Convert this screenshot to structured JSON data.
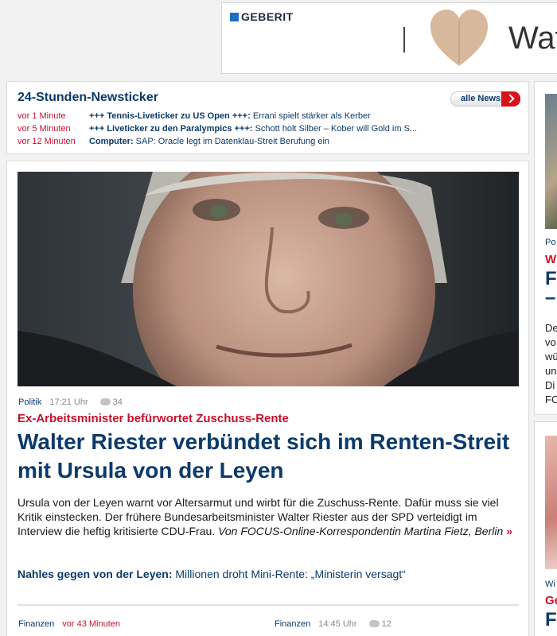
{
  "ad": {
    "brand": "GEBERIT",
    "slogan": "Wat"
  },
  "ticker": {
    "title": "24-Stunden-Newsticker",
    "all_news_label": "alle News",
    "items": [
      {
        "time": "vor 1 Minute",
        "category": "+++ Tennis-Liveticker zu US Open +++:",
        "text": "Errani spielt stärker als Kerber"
      },
      {
        "time": "vor 5 Minuten",
        "category": "+++ Liveticker zu den Paralympics +++:",
        "text": "Schott holt Silber – Kober will Gold im S..."
      },
      {
        "time": "vor 12 Minuten",
        "category": "Computer:",
        "text": "SAP: Oracle legt im Datenklau-Streit Berufung ein"
      }
    ]
  },
  "article": {
    "category": "Politik",
    "time": "17:21 Uhr",
    "comments": "34",
    "kicker": "Ex-Arbeitsminister befürwortet Zuschuss-Rente",
    "headline": "Walter Riester verbündet sich im Renten-Streit mit Ursula von der Leyen",
    "teaser": "Ursula von der Leyen warnt vor Altersarmut und wirbt für die Zuschuss-Rente. Dafür muss sie viel Kritik einstecken. Der frühere Bundesarbeitsminister Walter Riester aus der SPD verteidigt im Interview die heftig kritisierte CDU-Frau.",
    "author": "Von FOCUS-Online-Korrespondentin Martina Fietz, Berlin",
    "more": "»",
    "related_lead": "Nahles gegen von der Leyen:",
    "related_text": "Millionen droht Mini-Rente: „Ministerin versagt“"
  },
  "sub_articles": [
    {
      "category": "Finanzen",
      "relative_time": "vor 43 Minuten"
    },
    {
      "category": "Finanzen",
      "time": "14:45 Uhr",
      "comments": "12"
    }
  ],
  "right_column": {
    "card1": {
      "category": "Po",
      "kicker": "W",
      "headline": "Fe",
      "dash": "–",
      "body": "De\nvo\nwü\nun\nDi\nFO"
    },
    "card2": {
      "category": "Wi",
      "kicker": "Ge",
      "headline": "Fe"
    }
  },
  "colors": {
    "brand_blue": "#0b3a6b",
    "accent_red": "#c8102e"
  }
}
